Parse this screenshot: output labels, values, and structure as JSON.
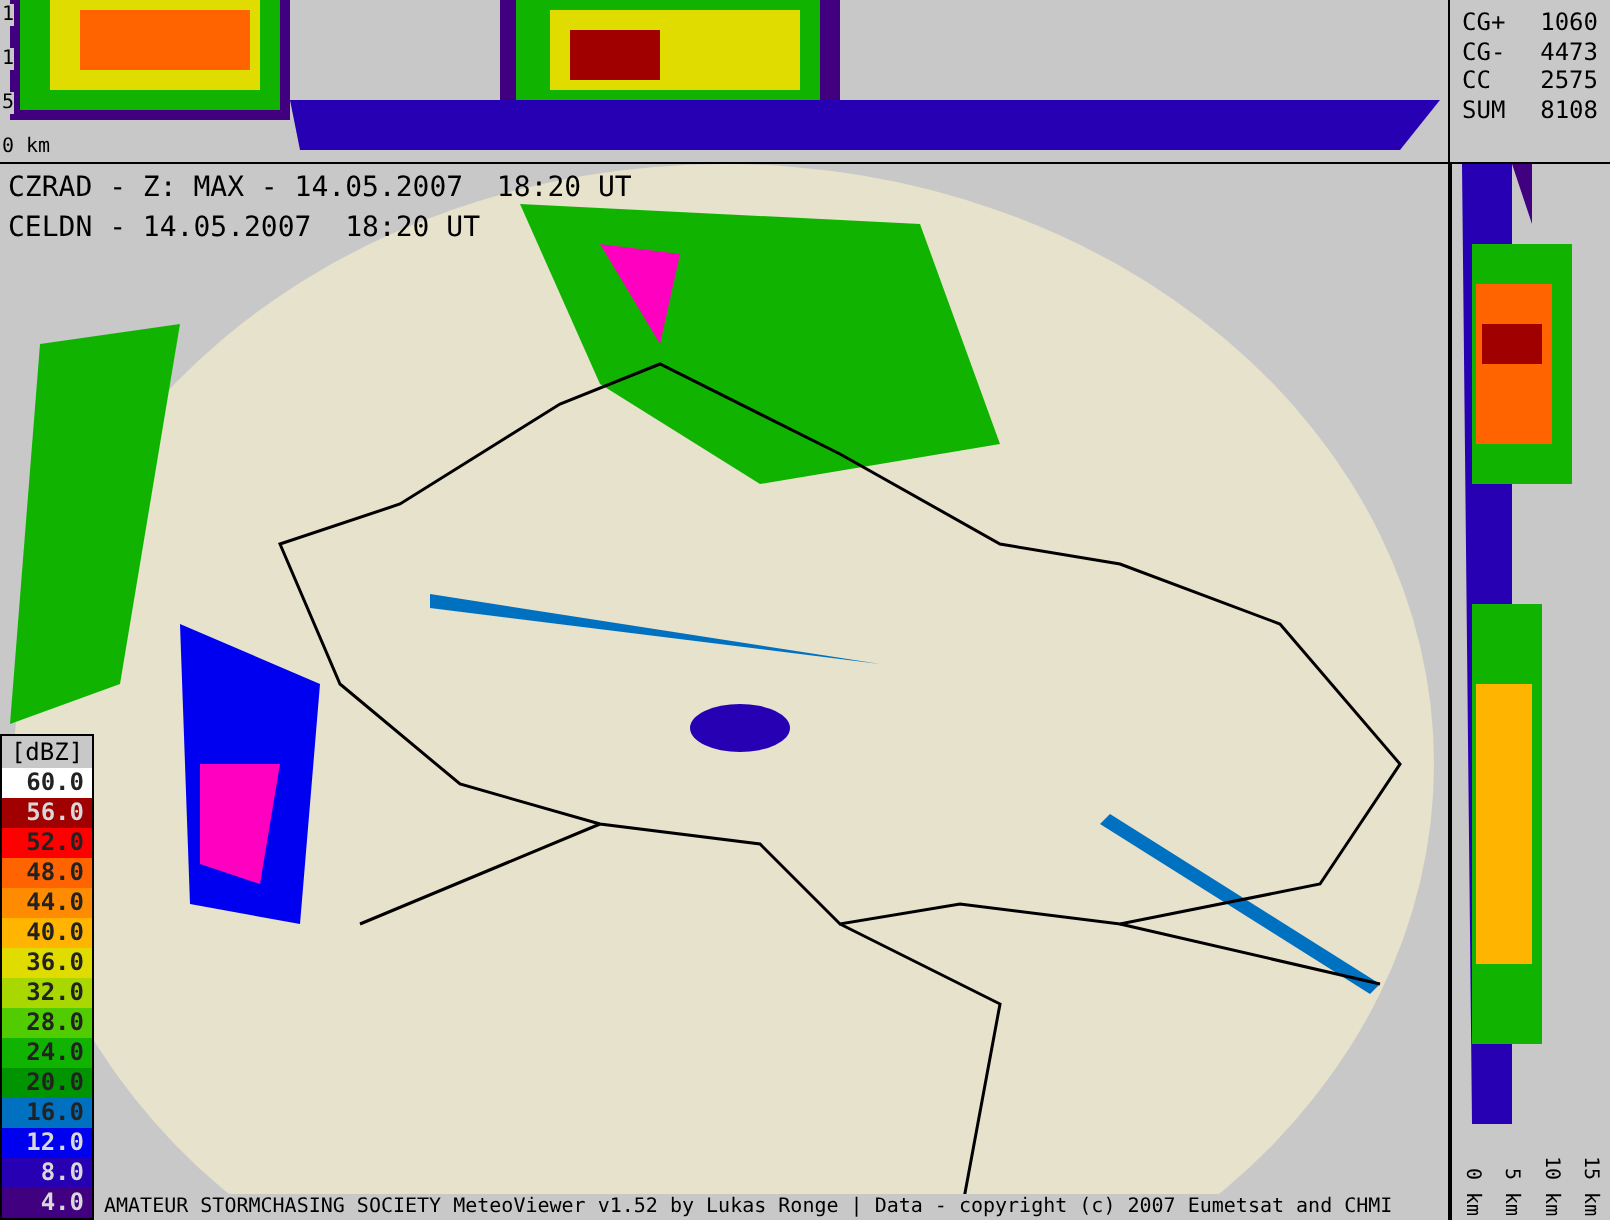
{
  "top_profile": {
    "axis_labels": [
      "1",
      "1",
      "5",
      "0 km"
    ]
  },
  "lightning_counts": [
    {
      "label": "CG+",
      "value": "1060"
    },
    {
      "label": "CG-",
      "value": "4473"
    },
    {
      "label": "CC",
      "value": "2575"
    },
    {
      "label": "SUM",
      "value": "8108"
    }
  ],
  "map": {
    "header_lines": [
      "CZRAD - Z: MAX - 14.05.2007  18:20 UT",
      "CELDN - 14.05.2007  18:20 UT"
    ]
  },
  "legend": {
    "title": "[dBZ]",
    "items": [
      {
        "label": "60.0",
        "color": "#ffffff"
      },
      {
        "label": "56.0",
        "color": "#a00000"
      },
      {
        "label": "52.0",
        "color": "#ff0000"
      },
      {
        "label": "48.0",
        "color": "#ff6400"
      },
      {
        "label": "44.0",
        "color": "#ff8c00"
      },
      {
        "label": "40.0",
        "color": "#ffb400"
      },
      {
        "label": "36.0",
        "color": "#e0dc00"
      },
      {
        "label": "32.0",
        "color": "#a8d800"
      },
      {
        "label": "28.0",
        "color": "#50cc00"
      },
      {
        "label": "24.0",
        "color": "#10b400"
      },
      {
        "label": "20.0",
        "color": "#009400"
      },
      {
        "label": "16.0",
        "color": "#0070c0"
      },
      {
        "label": "12.0",
        "color": "#0000f0"
      },
      {
        "label": "8.0",
        "color": "#2800b4"
      },
      {
        "label": "4.0",
        "color": "#400080"
      }
    ]
  },
  "side_profile": {
    "axis_labels": [
      "0 km",
      "5 km",
      "10 km",
      "15 km"
    ]
  },
  "footer": "AMATEUR STORMCHASING SOCIETY MeteoViewer v1.52 by Lukas Ronge | Data - copyright (c) 2007 Eumetsat and CHMI"
}
